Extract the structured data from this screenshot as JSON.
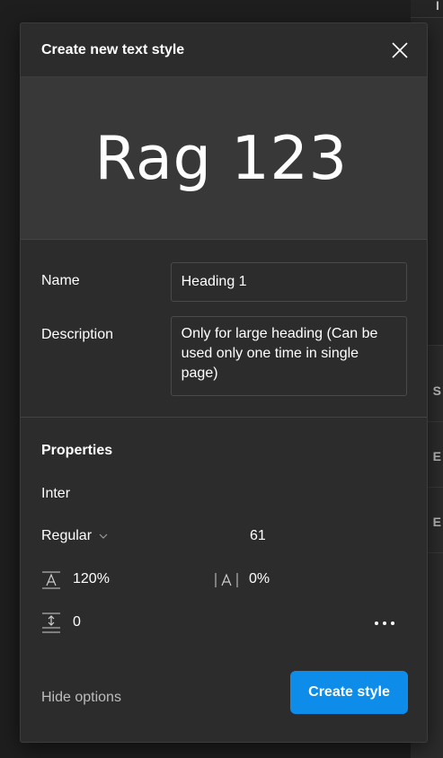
{
  "background": {
    "rows": [
      "S",
      "E",
      "E"
    ],
    "top_letter": "I"
  },
  "dialog": {
    "title": "Create new text style",
    "preview_text": "Rag 123",
    "fields": {
      "name_label": "Name",
      "name_value": "Heading 1",
      "description_label": "Description",
      "description_value": "Only for large heading (Can be used only one time in single page)"
    },
    "properties": {
      "title": "Properties",
      "font_family": "Inter",
      "font_weight": "Regular",
      "font_size": "61",
      "line_height": "120%",
      "letter_spacing": "0%",
      "paragraph_spacing": "0"
    },
    "footer": {
      "hide_options_label": "Hide options",
      "create_button_label": "Create style"
    },
    "colors": {
      "accent": "#0d8ce9",
      "dialog_bg": "#2c2c2c",
      "preview_bg": "#383838"
    }
  }
}
